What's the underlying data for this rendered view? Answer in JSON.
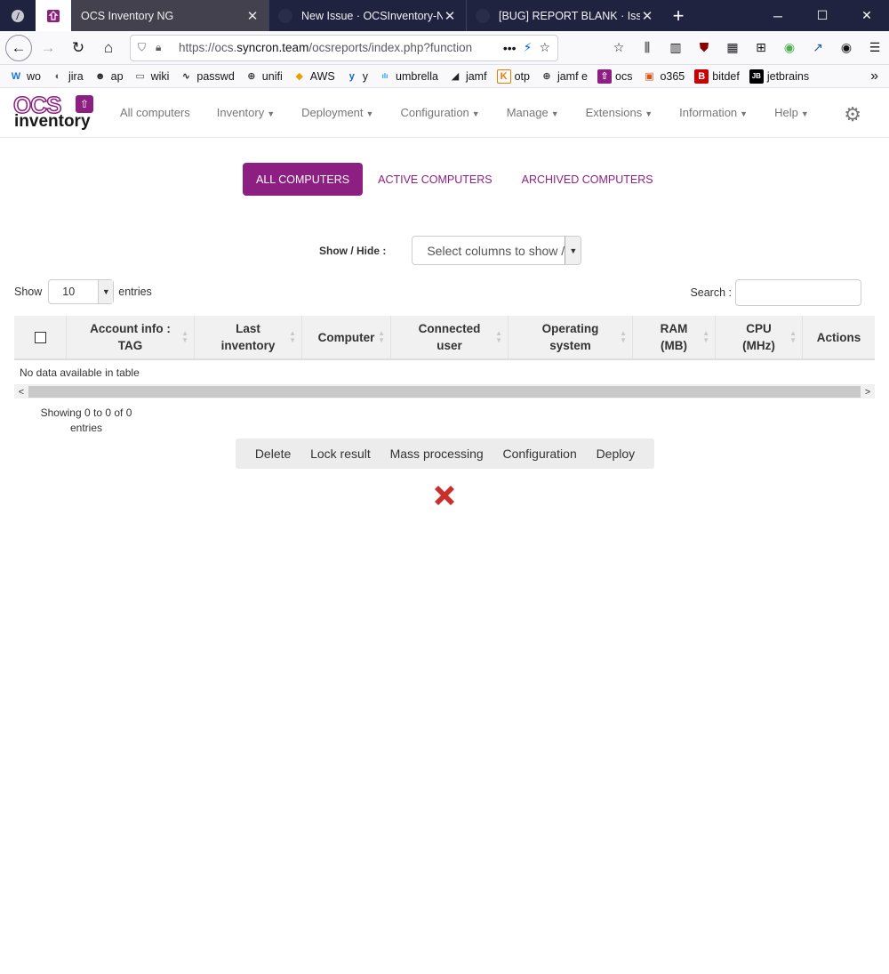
{
  "browser": {
    "tabs": [
      {
        "title": "OCS Inventory NG",
        "active": true
      },
      {
        "title": "New Issue · OCSInventory-NG/"
      },
      {
        "title": "[BUG] REPORT BLANK · Issue #"
      }
    ],
    "new_tab": "+",
    "window_controls": {
      "minimize": "─",
      "maximize": "☐",
      "close": "✕"
    },
    "url_prefix": "https://ocs.",
    "url_host": "syncron.team",
    "url_rest": "/ocsreports/index.php?function",
    "bookmarks": [
      {
        "label": "wo",
        "icon": "w-icon",
        "glyph": "W",
        "color": "#1a73e8"
      },
      {
        "label": "jira",
        "icon": "jira-icon",
        "glyph": "◐",
        "color": "#555"
      },
      {
        "label": "ap",
        "icon": "panda-icon",
        "glyph": "☻",
        "color": "#222"
      },
      {
        "label": "wiki",
        "icon": "folder-icon",
        "glyph": "▭",
        "color": "#555"
      },
      {
        "label": "passwd",
        "icon": "pulse-icon",
        "glyph": "∿",
        "color": "#222"
      },
      {
        "label": "unifi",
        "icon": "globe-icon",
        "glyph": "⊕",
        "color": "#333"
      },
      {
        "label": "AWS",
        "icon": "aws-icon",
        "glyph": "◆",
        "color": "#e8a000"
      },
      {
        "label": "y",
        "icon": "yammer-icon",
        "glyph": "y",
        "color": "#1565c0"
      },
      {
        "label": "umbrella",
        "icon": "cisco-icon",
        "glyph": "ılı",
        "color": "#1ba0d7"
      },
      {
        "label": "jamf",
        "icon": "jamf-icon",
        "glyph": "◢",
        "color": "#222"
      },
      {
        "label": "otp",
        "icon": "k-icon",
        "glyph": "K",
        "color": "#e67e00"
      },
      {
        "label": "jamf e",
        "icon": "globe-icon",
        "glyph": "⊕",
        "color": "#333"
      },
      {
        "label": "ocs",
        "icon": "ocs-icon",
        "glyph": "⇧",
        "color": "#8e1f82"
      },
      {
        "label": "o365",
        "icon": "office-icon",
        "glyph": "▣",
        "color": "#e2531c"
      },
      {
        "label": "bitdef",
        "icon": "bitdefender-icon",
        "glyph": "B",
        "color": "#c00"
      },
      {
        "label": "jetbrains",
        "icon": "jetbrains-icon",
        "glyph": "JB",
        "color": "#000"
      }
    ],
    "bookmarks_more": "»"
  },
  "app": {
    "logo_top": "OCS",
    "logo_bottom": "inventory",
    "menu": [
      {
        "label": "All computers",
        "dropdown": false
      },
      {
        "label": "Inventory",
        "dropdown": true
      },
      {
        "label": "Deployment",
        "dropdown": true
      },
      {
        "label": "Configuration",
        "dropdown": true
      },
      {
        "label": "Manage",
        "dropdown": true
      },
      {
        "label": "Extensions",
        "dropdown": true
      },
      {
        "label": "Information",
        "dropdown": true
      },
      {
        "label": "Help",
        "dropdown": true
      }
    ],
    "accent": "#8e1f82"
  },
  "content": {
    "pills": [
      "ALL COMPUTERS",
      "ACTIVE COMPUTERS",
      "ARCHIVED COMPUTERS"
    ],
    "show_hide_label": "Show / Hide :",
    "select_columns_placeholder": "Select columns to show / hide",
    "show_label": "Show",
    "entries_value": "10",
    "entries_label": "entries",
    "search_label": "Search :",
    "search_value": "",
    "columns": [
      "Account info : TAG",
      "Last inventory",
      "Computer",
      "Connected user",
      "Operating system",
      "RAM (MB)",
      "CPU (MHz)",
      "Actions"
    ],
    "no_data": "No data available in table",
    "info": "Showing 0 to 0 of 0 entries",
    "actions": [
      "Delete",
      "Lock result",
      "Mass processing",
      "Configuration",
      "Deploy"
    ]
  }
}
